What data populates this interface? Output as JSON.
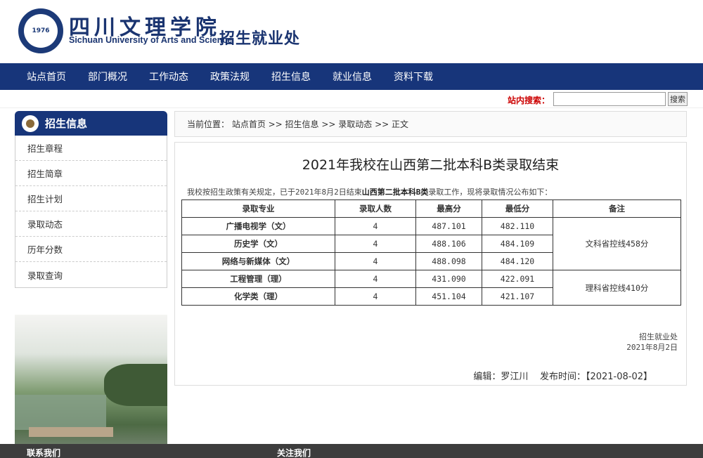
{
  "header": {
    "school_cn": "四川文理学院",
    "school_en": "Sichuan University of Arts and Science",
    "dept": "招生就业处",
    "logo_year": "1976"
  },
  "nav": {
    "items": [
      "站点首页",
      "部门概况",
      "工作动态",
      "政策法规",
      "招生信息",
      "就业信息",
      "资料下载"
    ]
  },
  "search": {
    "label": "站内搜索：",
    "value": "",
    "button": "搜索"
  },
  "sidebar": {
    "title": "招生信息",
    "items": [
      "招生章程",
      "招生简章",
      "招生计划",
      "录取动态",
      "历年分数",
      "录取查询"
    ]
  },
  "breadcrumb": {
    "text": "当前位置： 站点首页 >> 招生信息 >> 录取动态 >> 正文"
  },
  "article": {
    "title": "2021年我校在山西第二批本科B类录取结束",
    "intro_pre": "我校按招生政策有关规定，已于2021年8月2日结束",
    "intro_bold": "山西第二批本科B类",
    "intro_post": "录取工作，现将录取情况公布如下：",
    "table": {
      "headers": [
        "录取专业",
        "录取人数",
        "最高分",
        "最低分",
        "备注"
      ],
      "rows": [
        [
          "广播电视学（文）",
          "4",
          "487.101",
          "482.110"
        ],
        [
          "历史学（文）",
          "4",
          "488.106",
          "484.109"
        ],
        [
          "网络与新媒体（文）",
          "4",
          "488.098",
          "484.120"
        ],
        [
          "工程管理（理）",
          "4",
          "431.090",
          "422.091"
        ],
        [
          "化学类（理）",
          "4",
          "451.104",
          "421.107"
        ]
      ],
      "note_wen": "文科省控线458分",
      "note_li": "理科省控线410分"
    },
    "sign_dept": "招生就业处",
    "sign_date": "2021年8月2日",
    "editor": "编辑：罗江川",
    "publish": "发布时间：【2021-08-02】"
  },
  "footer": {
    "contact": "联系我们",
    "follow": "关注我们"
  }
}
